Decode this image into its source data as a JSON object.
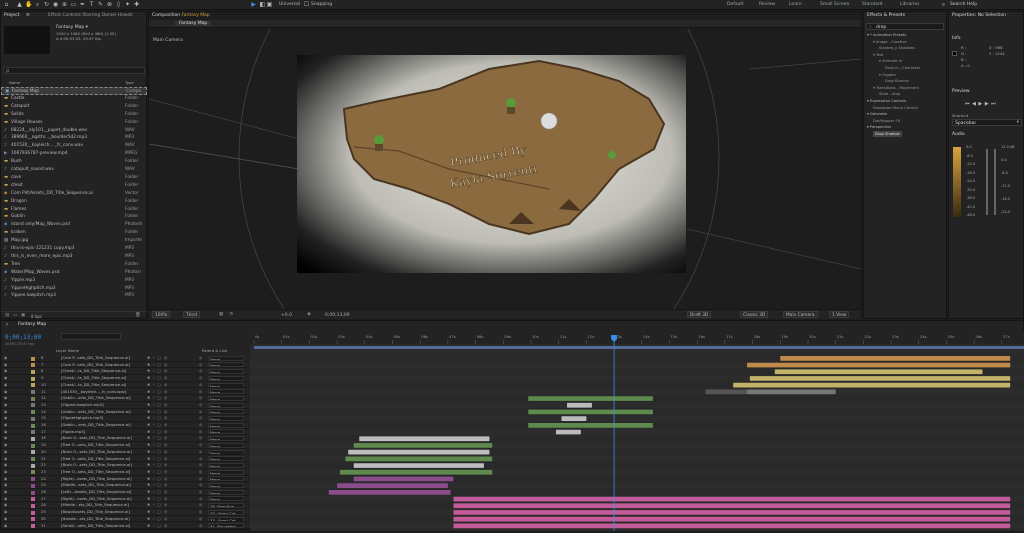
{
  "workspaces": [
    "Default",
    "Review",
    "Learn",
    "Small Screen",
    "Standard",
    "Libraries"
  ],
  "search_help": "Search Help",
  "toolbar_checks": [
    "Universal",
    "Snapping"
  ],
  "project": {
    "tab": "Project",
    "menu": "≡",
    "tab2": "Effect Controls Starring Daniel Howell",
    "thumb_title": "Fantasy Map ▾",
    "thumb_info1": "1920 x 1080 (640 x 360) (1.00)",
    "thumb_info2": "Δ 0;00;53;05, 29.97 fps",
    "search_ph": "ρ",
    "col_name": "Name",
    "col_type": "Type",
    "items": [
      {
        "name": "Fantasy Map",
        "type": "Compo",
        "icon": "comp",
        "sel": true
      },
      {
        "name": "Castle",
        "type": "Folder",
        "icon": "folder"
      },
      {
        "name": "Catapult",
        "type": "Folder",
        "icon": "folder"
      },
      {
        "name": "Solids",
        "type": "Folder",
        "icon": "folder"
      },
      {
        "name": "Village Houses",
        "type": "Folder",
        "icon": "folder"
      },
      {
        "name": "68224__ely101__pupet_double.wav",
        "type": "WAV",
        "icon": "audio"
      },
      {
        "name": "389660__ogsthr..._boulder5d2.mp3",
        "type": "MP3",
        "icon": "audio"
      },
      {
        "name": "401530__kayleich...._fc_conv.wav",
        "type": "WAV",
        "icon": "audio"
      },
      {
        "name": "1087936787-preview.mp4",
        "type": "MPEG",
        "icon": "video"
      },
      {
        "name": "Bush",
        "type": "Folder",
        "icon": "folder"
      },
      {
        "name": "catapult_sound.wav",
        "type": "WAV",
        "icon": "audio"
      },
      {
        "name": "cave",
        "type": "Folder",
        "icon": "folder"
      },
      {
        "name": "chest",
        "type": "Folder",
        "icon": "folder"
      },
      {
        "name": "Com Pilt/Assets_DD_Title_Sequence.ai",
        "type": "Vector",
        "icon": "ai"
      },
      {
        "name": "Dragon",
        "type": "Folder",
        "icon": "folder"
      },
      {
        "name": "Flames",
        "type": "Folder",
        "icon": "folder"
      },
      {
        "name": "Goblin",
        "type": "Folder",
        "icon": "folder"
      },
      {
        "name": "island only/Map_Waves.psd",
        "type": "Photosh",
        "icon": "psd"
      },
      {
        "name": "kraken",
        "type": "Folder",
        "icon": "folder"
      },
      {
        "name": "Map.jpg",
        "type": "Importe",
        "icon": "image"
      },
      {
        "name": "this-is-epic-121231 copy.mp3",
        "type": "MP3",
        "icon": "audio"
      },
      {
        "name": "this_is_even_more_epic.mp3",
        "type": "MP3",
        "icon": "audio"
      },
      {
        "name": "Tree",
        "type": "Folder",
        "icon": "folder"
      },
      {
        "name": "Water/Map_Waves.psd",
        "type": "Photosl",
        "icon": "psd"
      },
      {
        "name": "Yippie.mp3",
        "type": "MP3",
        "icon": "audio"
      },
      {
        "name": "YippieHighpitch.mp3",
        "type": "MP3",
        "icon": "audio"
      },
      {
        "name": "Yippee.lowpitch.mp3",
        "type": "MP3",
        "icon": "audio"
      }
    ],
    "footer_bpc": "8 bpc"
  },
  "comp": {
    "tab": "Composition",
    "comp_name": "Fantasy Map",
    "sub_tab": "Fantasy Map",
    "camera_label": "Main Camera",
    "title_line1": "Produced By",
    "title_line2": "Kayla Sorrenti",
    "zoom": "100%",
    "quality": "Third",
    "res": "+0.0",
    "timecode": "0;00;13;09",
    "renderer": "Classic 3D",
    "draft": "Draft 3D",
    "camera": "Main Camera",
    "views": "1 View",
    "colors": {
      "map": "#8a6a3e",
      "map_dark": "#5d432a",
      "vignette": "#c8c8c0"
    }
  },
  "effects": {
    "tab": "Effects & Presets",
    "search_value": "drop",
    "tree": [
      {
        "t": "▾ * Animation Presets",
        "lvl": 0
      },
      {
        "t": "▾ Image - Creative",
        "lvl": 1
      },
      {
        "t": "Slanted_p Shadows",
        "lvl": 2
      },
      {
        "t": "▾ Text",
        "lvl": 1
      },
      {
        "t": "▾ Animate In",
        "lvl": 2
      },
      {
        "t": "Drop-in...Character",
        "lvl": 3
      },
      {
        "t": "▾ Organic",
        "lvl": 2
      },
      {
        "t": "Drop Bounce",
        "lvl": 3
      },
      {
        "t": "▾ Transitions - Movement",
        "lvl": 1
      },
      {
        "t": "Slide - drop",
        "lvl": 2
      },
      {
        "t": "▾ Expression Controls",
        "lvl": 0
      },
      {
        "t": "Dropdown Menu Control",
        "lvl": 1
      },
      {
        "t": "▾ Generate",
        "lvl": 0
      },
      {
        "t": "Dot/Hopper FX",
        "lvl": 1
      },
      {
        "t": "▾ Perspective",
        "lvl": 0
      },
      {
        "t": "Drop Shadow",
        "lvl": 1,
        "sel": true
      }
    ]
  },
  "properties": {
    "tab": "Properties: No Selection",
    "info_tab": "Info",
    "info_lines": [
      "R :",
      "G :",
      "B :",
      "A : 0"
    ],
    "info_xy": [
      "X : 968",
      "Y : 1244"
    ],
    "preview_tab": "Preview",
    "shortcut_label": "Shortcut",
    "shortcut_value": "Spacebar",
    "audio_tab": "Audio",
    "audio_db": [
      "0.0",
      "-6.0",
      "-12.0",
      "-18.0",
      "-24.0",
      "-30.0",
      "-36.0",
      "-42.0",
      "-48.0"
    ],
    "audio_db_r": [
      "12.0 dB",
      "0.0",
      "-6.0",
      "-12.0",
      "-18.0",
      "-24.0"
    ]
  },
  "timeline": {
    "tab": "Fantasy Map",
    "timecode": "0;00;13;00",
    "timecode_sub": "00390 (29.97 fps)",
    "col_layer": "Layer Name",
    "col_parent": "Parent & Link",
    "ruler": [
      "0s",
      "01s",
      "02s",
      "03s",
      "04s",
      "05s",
      "06s",
      "07s",
      "08s",
      "09s",
      "10s",
      "11s",
      "12s",
      "13s",
      "14s",
      "15s",
      "16s",
      "17s",
      "18s",
      "19s",
      "20s",
      "21s",
      "22s",
      "23s",
      "24s",
      "25s",
      "26s",
      "27s"
    ],
    "layers": [
      {
        "n": "6",
        "name": "[Com P...sets_DD_Title_Sequence.ai]",
        "parent": "None",
        "lc": "#c28c4d"
      },
      {
        "n": "7",
        "name": "[Com P...sets_DD_Title_Sequence.ai]",
        "parent": "None",
        "lc": "#c28c4d"
      },
      {
        "n": "8",
        "name": "[Chest/...ts_DD_Title_Sequence.ai]",
        "parent": "None",
        "lc": "#b8a560"
      },
      {
        "n": "9",
        "name": "[Chest/...ts_DD_Title_Sequence.ai]",
        "parent": "None",
        "lc": "#b8a560"
      },
      {
        "n": "10",
        "name": "[Chest/...ts_DD_Title_Sequence.ai]",
        "parent": "None",
        "lc": "#b8a560"
      },
      {
        "n": "11",
        "name": "[401530__kayleich..._fc_conv.wav]",
        "parent": "None",
        "lc": "#777"
      },
      {
        "n": "12",
        "name": "[Goblin...sets_DD_Title_Sequence.ai]",
        "parent": "None",
        "lc": "#6b8a52"
      },
      {
        "n": "13",
        "name": "[Yippee.lowpitch.mp3]",
        "parent": "None",
        "lc": "#777"
      },
      {
        "n": "14",
        "name": "[Goblin...sets_DD_Title_Sequence.ai]",
        "parent": "None",
        "lc": "#6b8a52"
      },
      {
        "n": "15",
        "name": "[YippieHighpitch.mp3]",
        "parent": "None",
        "lc": "#777"
      },
      {
        "n": "16",
        "name": "[Goblin...sets_DD_Title_Sequence.ai]",
        "parent": "None",
        "lc": "#6b8a52"
      },
      {
        "n": "17",
        "name": "[Yippie.mp3]",
        "parent": "None",
        "lc": "#777"
      },
      {
        "n": "18",
        "name": "[Bush O...sets_DD_Title_Sequence.ai]",
        "parent": "None",
        "lc": "#aaa"
      },
      {
        "n": "19",
        "name": "[Tree O...sets_DD_Title_Sequence.ai]",
        "parent": "None",
        "lc": "#6b8a52"
      },
      {
        "n": "20",
        "name": "[Bush O...sets_DD_Title_Sequence.ai]",
        "parent": "None",
        "lc": "#aaa"
      },
      {
        "n": "21",
        "name": "[Tree O...sets_DD_Title_Sequence.ai]",
        "parent": "None",
        "lc": "#6b8a52"
      },
      {
        "n": "22",
        "name": "[Bush O...sets_DD_Title_Sequence.ai]",
        "parent": "None",
        "lc": "#aaa"
      },
      {
        "n": "23",
        "name": "[Tree O...sets_DD_Title_Sequence.ai]",
        "parent": "None",
        "lc": "#6b8a52"
      },
      {
        "n": "24",
        "name": "[Right/...ssets_DD_Title_Sequence.ai]",
        "parent": "None",
        "lc": "#8a4c8a"
      },
      {
        "n": "25",
        "name": "[Middle...sets_DD_Title_Sequence.ai]",
        "parent": "None",
        "lc": "#8a4c8a"
      },
      {
        "n": "26",
        "name": "[Left/...Assets_DD_Title_Sequence.ai]",
        "parent": "None",
        "lc": "#8a4c8a"
      },
      {
        "n": "27",
        "name": "[Right/...ssets_DD_Title_Sequence.ai]",
        "parent": "None",
        "lc": "#c35b9a"
      },
      {
        "n": "28",
        "name": "[Middle...ets_DD_Title_Sequence.ai]",
        "parent": "28. Bow/Arw",
        "lc": "#c35b9a"
      },
      {
        "n": "29",
        "name": "[Bowl/Assets_DD_Title_Sequence.ai]",
        "parent": "33. (Arm) Cat",
        "lc": "#c35b9a"
      },
      {
        "n": "30",
        "name": "[Handle...ets_DD_Title_Sequence.ai]",
        "parent": "33. (Arm) Cat",
        "lc": "#c35b9a"
      },
      {
        "n": "31",
        "name": "[Small/...sets_DD_Title_Sequence.ai]",
        "parent": "31. Big wheel",
        "lc": "#c35b9a"
      }
    ],
    "tracks": [
      [
        {
          "s": 19.0,
          "e": 27.3,
          "c": "#c08a4a"
        }
      ],
      [
        {
          "s": 17.8,
          "e": 27.3,
          "c": "#c08a4a"
        }
      ],
      [
        {
          "s": 18.8,
          "e": 26.3,
          "c": "#c2b26a"
        }
      ],
      [
        {
          "s": 17.9,
          "e": 27.3,
          "c": "#c2b26a"
        }
      ],
      [
        {
          "s": 17.3,
          "e": 27.3,
          "c": "#c2b26a"
        }
      ],
      [
        {
          "s": 16.3,
          "e": 17.8,
          "c": "#555"
        },
        {
          "s": 17.8,
          "e": 21.0,
          "c": "#777"
        }
      ],
      [
        {
          "s": 9.9,
          "e": 14.4,
          "c": "#5f8a4e"
        }
      ],
      [
        {
          "s": 11.3,
          "e": 12.2,
          "c": "#bbb"
        }
      ],
      [
        {
          "s": 9.9,
          "e": 14.4,
          "c": "#5f8a4e"
        }
      ],
      [
        {
          "s": 11.1,
          "e": 12.0,
          "c": "#bbb"
        }
      ],
      [
        {
          "s": 9.9,
          "e": 14.4,
          "c": "#5f8a4e"
        }
      ],
      [
        {
          "s": 10.9,
          "e": 11.8,
          "c": "#bbb"
        }
      ],
      [
        {
          "s": 3.8,
          "e": 8.5,
          "c": "#bdbdbd"
        }
      ],
      [
        {
          "s": 3.6,
          "e": 8.6,
          "c": "#5f8a4e"
        }
      ],
      [
        {
          "s": 3.4,
          "e": 8.5,
          "c": "#bdbdbd"
        }
      ],
      [
        {
          "s": 3.3,
          "e": 8.6,
          "c": "#5f8a4e"
        }
      ],
      [
        {
          "s": 3.6,
          "e": 8.3,
          "c": "#bdbdbd"
        }
      ],
      [
        {
          "s": 3.1,
          "e": 8.6,
          "c": "#5f8a4e"
        }
      ],
      [
        {
          "s": 3.6,
          "e": 7.2,
          "c": "#8a4c8a"
        }
      ],
      [
        {
          "s": 3.0,
          "e": 7.0,
          "c": "#8a4c8a"
        }
      ],
      [
        {
          "s": 2.7,
          "e": 7.1,
          "c": "#8a4c8a"
        }
      ],
      [
        {
          "s": 7.2,
          "e": 27.3,
          "c": "#c35b9a"
        }
      ],
      [
        {
          "s": 7.2,
          "e": 27.3,
          "c": "#c35b9a"
        }
      ],
      [
        {
          "s": 7.2,
          "e": 27.3,
          "c": "#c35b9a"
        }
      ],
      [
        {
          "s": 7.2,
          "e": 27.3,
          "c": "#c35b9a"
        }
      ],
      [
        {
          "s": 7.2,
          "e": 27.3,
          "c": "#c35b9a"
        }
      ]
    ],
    "playhead": 13.0,
    "track_bg": "#2a2a2a"
  }
}
